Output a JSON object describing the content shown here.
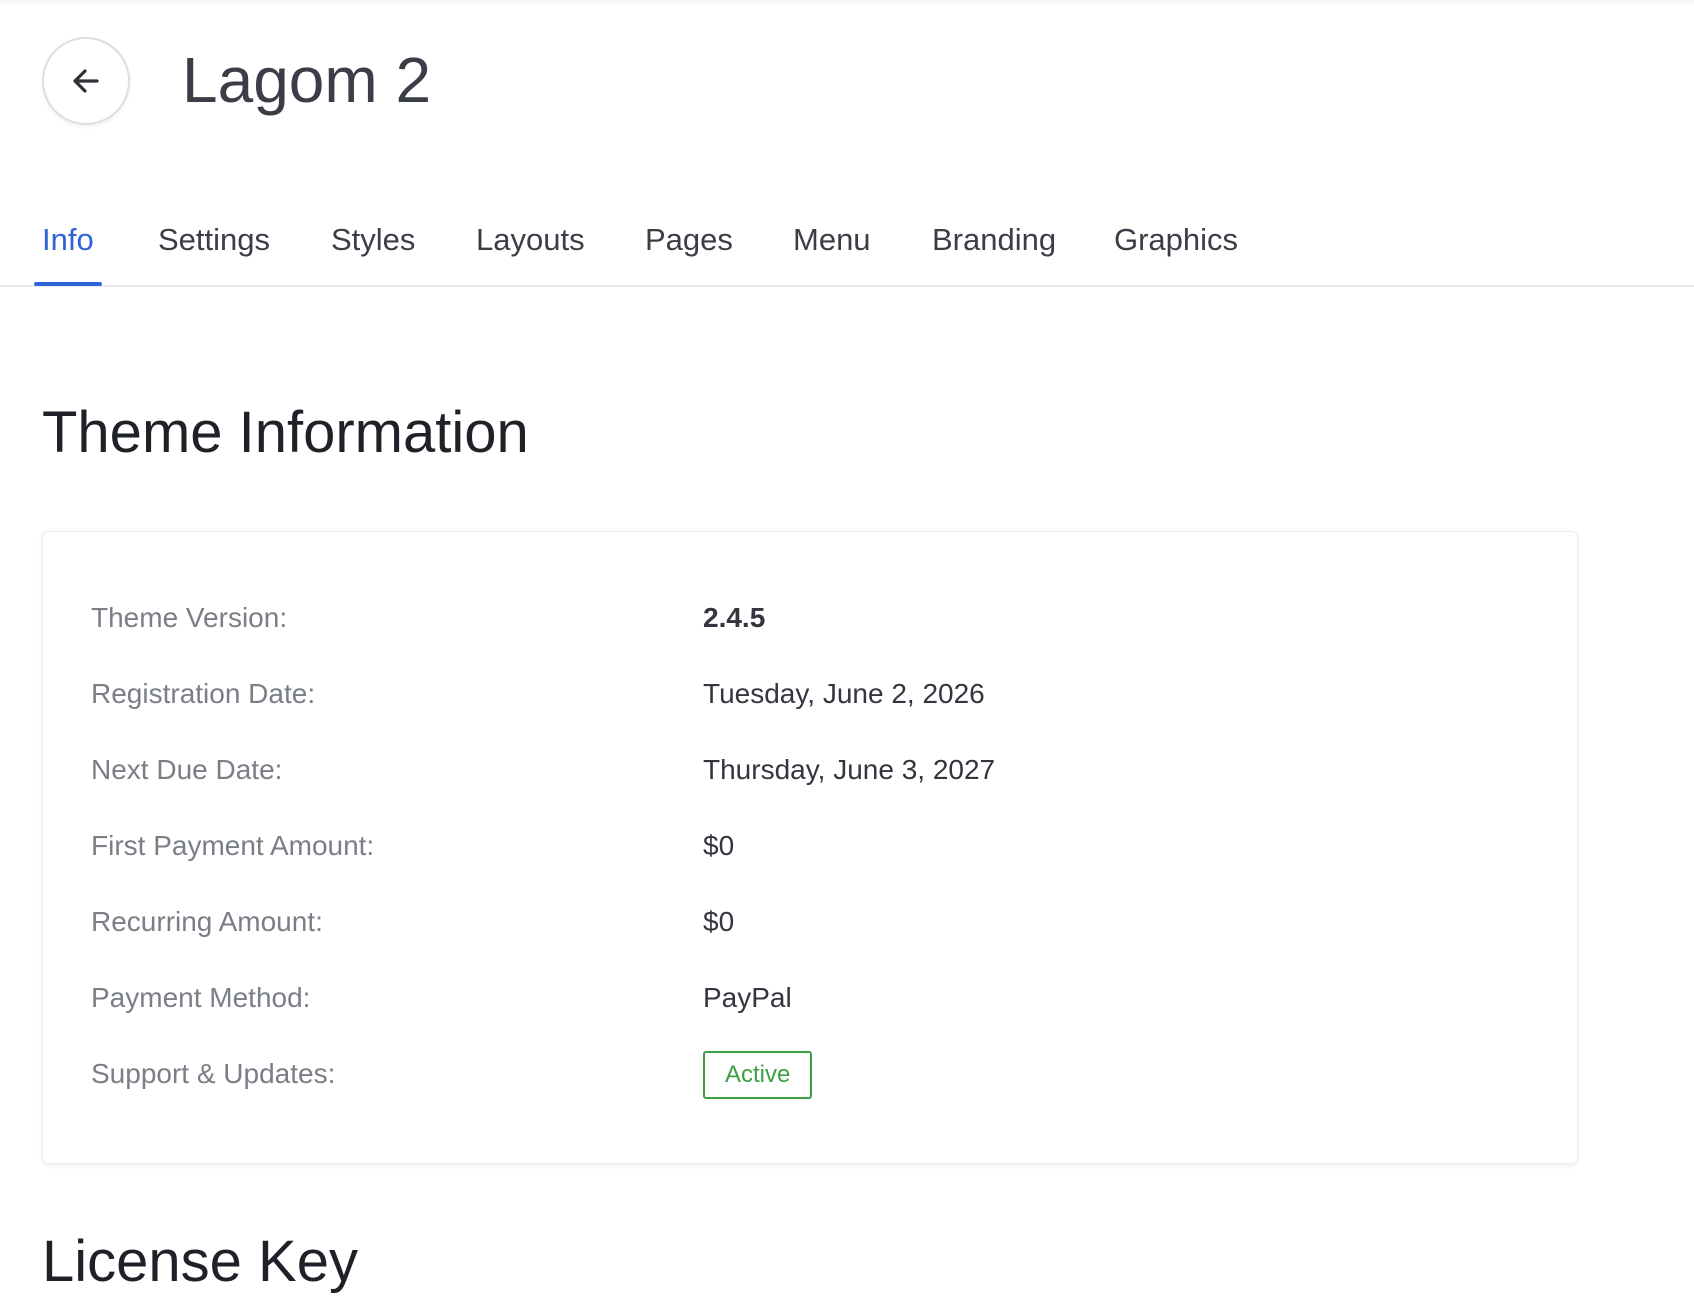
{
  "header": {
    "title": "Lagom 2",
    "back_icon": "arrow-left-icon"
  },
  "tabs": [
    {
      "label": "Info",
      "active": true
    },
    {
      "label": "Settings",
      "active": false
    },
    {
      "label": "Styles",
      "active": false
    },
    {
      "label": "Layouts",
      "active": false
    },
    {
      "label": "Pages",
      "active": false
    },
    {
      "label": "Menu",
      "active": false
    },
    {
      "label": "Branding",
      "active": false
    },
    {
      "label": "Graphics",
      "active": false
    }
  ],
  "theme_info": {
    "title": "Theme Information",
    "rows": [
      {
        "label": "Theme Version:",
        "value": "2.4.5"
      },
      {
        "label": "Registration Date:",
        "value": "Tuesday, June 2, 2026"
      },
      {
        "label": "Next Due Date:",
        "value": "Thursday, June 3, 2027"
      },
      {
        "label": "First Payment Amount:",
        "value": "$0"
      },
      {
        "label": "Recurring Amount:",
        "value": "$0"
      },
      {
        "label": "Payment Method:",
        "value": "PayPal"
      },
      {
        "label": "Support & Updates:",
        "value": "Active"
      }
    ]
  },
  "license": {
    "title": "License Key"
  },
  "colors": {
    "accent": "#2f63d8",
    "status_active": "#3aa043",
    "text": "#3b3e47",
    "label": "#7a7e87"
  }
}
